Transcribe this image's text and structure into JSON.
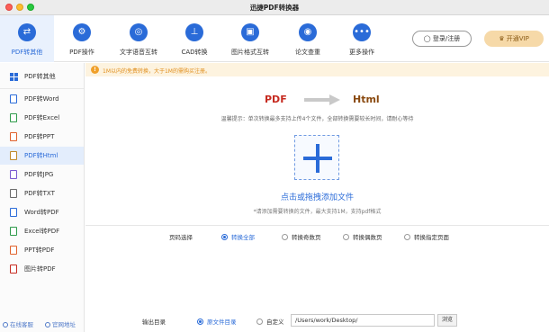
{
  "window": {
    "title": "迅捷PDF转换器"
  },
  "toolbar": {
    "tabs": [
      {
        "label": "PDF转其他",
        "icon": "document-convert-icon"
      },
      {
        "label": "PDF操作",
        "icon": "gear-icon"
      },
      {
        "label": "文字语音互转",
        "icon": "audio-icon"
      },
      {
        "label": "CAD转换",
        "icon": "ruler-icon"
      },
      {
        "label": "图片格式互转",
        "icon": "image-icon"
      },
      {
        "label": "论文查重",
        "icon": "paper-check-icon"
      },
      {
        "label": "更多操作",
        "icon": "more-icon"
      }
    ],
    "active_index": 0,
    "login_label": "登录/注册",
    "vip_label": "开通VIP"
  },
  "sidebar": {
    "items": [
      {
        "label": "PDF转其他"
      },
      {
        "label": "PDF转Word"
      },
      {
        "label": "PDF转Excel"
      },
      {
        "label": "PDF转PPT"
      },
      {
        "label": "PDF转Html"
      },
      {
        "label": "PDF转JPG"
      },
      {
        "label": "PDF转TXT"
      },
      {
        "label": "Word转PDF"
      },
      {
        "label": "Excel转PDF"
      },
      {
        "label": "PPT转PDF"
      },
      {
        "label": "图片转PDF"
      }
    ],
    "active_index": 4,
    "footer": {
      "service_label": "在线客服",
      "site_label": "官网地址"
    }
  },
  "notice": {
    "text": "1M以内的免费转换，大于1M的需购买注册。"
  },
  "conversion": {
    "from": "PDF",
    "to": "Html"
  },
  "hint": {
    "text": "温馨提示：单次转换最多支持上传4个文件，全部转换需要较长时间，请耐心等待"
  },
  "dropzone": {
    "label": "点击或拖拽添加文件",
    "sublabel": "*请添加需要转换的文件，最大支持1M，支持pdf格式"
  },
  "page_select": {
    "label": "页码选择",
    "options": [
      "转换全部",
      "转换奇数页",
      "转换偶数页",
      "转换指定页面"
    ],
    "selected_index": 0
  },
  "output": {
    "label": "输出目录",
    "options": [
      "原文件目录",
      "自定义"
    ],
    "selected_index": 0,
    "path": "/Users/work/Desktop/",
    "browse_label": "浏览"
  },
  "colors": {
    "accent": "#2a6bd8",
    "warning": "#e08e1c",
    "pdf": "#c62a20",
    "html": "#8a4a10",
    "vip_bg": "#f6d9a8"
  }
}
